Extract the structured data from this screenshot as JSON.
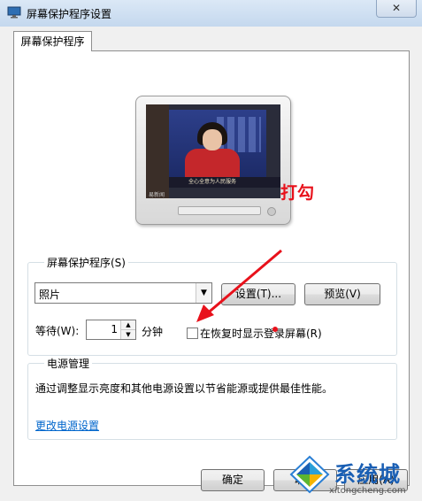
{
  "window": {
    "title": "屏幕保护程序设置",
    "close_glyph": "✕"
  },
  "tab": {
    "label": "屏幕保护程序"
  },
  "preview": {
    "ticker": "全心全意为人民服务",
    "corner_logo": "易新闻"
  },
  "annotation": {
    "text": "打勾",
    "color": "#e8111b"
  },
  "screensaver": {
    "group_title": "屏幕保护程序(S)",
    "selected": "照片",
    "settings_label": "设置(T)...",
    "preview_label": "预览(V)",
    "wait_label": "等待(W):",
    "wait_value": "1",
    "minutes_label": "分钟",
    "resume_logon_label": "在恢复时显示登录屏幕(R)",
    "resume_logon_checked": false
  },
  "power": {
    "group_title": "电源管理",
    "description": "通过调整显示亮度和其他电源设置以节省能源或提供最佳性能。",
    "link": "更改电源设置"
  },
  "footer": {
    "ok_label": "确定",
    "cancel_label": "取消",
    "apply_label": "应用(A)"
  },
  "watermark": {
    "brand": "系统城",
    "url": "xitongcheng.com"
  }
}
